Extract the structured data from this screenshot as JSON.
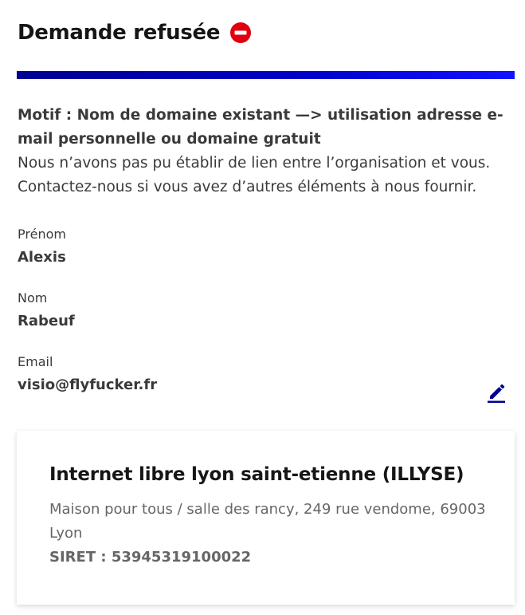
{
  "header": {
    "title": "Demande refusée",
    "status_icon": "minus-circle-icon",
    "status_color": "#e1000f"
  },
  "accent_color": "#000091",
  "reason": {
    "motif": "Motif : Nom de domaine existant —> utilisation adresse e-mail personnelle ou domaine gratuit",
    "line1": "Nous n’avons pas pu établir de lien entre l’organisation et vous.",
    "line2": "Contactez-nous si vous avez d’autres éléments à nous fournir."
  },
  "fields": {
    "firstname": {
      "label": "Prénom",
      "value": "Alexis"
    },
    "lastname": {
      "label": "Nom",
      "value": "Rabeuf"
    },
    "email": {
      "label": "Email",
      "value": "visio@flyfucker.fr"
    }
  },
  "edit_icon": "pencil-icon",
  "organization": {
    "name": "Internet libre lyon saint-etienne (ILLYSE)",
    "address": "Maison pour tous / salle des rancy, 249 rue vendome, 69003 Lyon",
    "siret": "SIRET : 53945319100022"
  }
}
